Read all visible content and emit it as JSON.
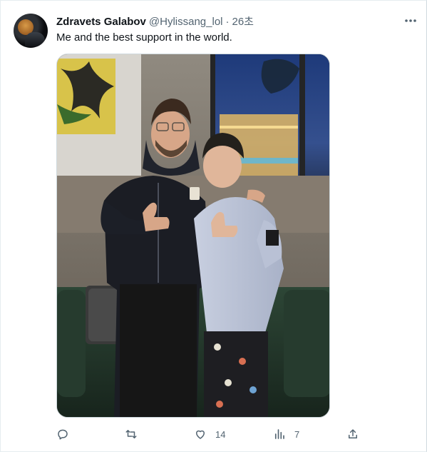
{
  "tweet": {
    "author_name": "Zdravets Galabov",
    "handle": "@Hylissang_lol",
    "separator": "·",
    "time": "26초",
    "text": "Me and the best support in the world.",
    "more_glyph": "•••"
  },
  "actions": {
    "reply": {
      "icon": "reply-icon",
      "count": ""
    },
    "retweet": {
      "icon": "retweet-icon",
      "count": ""
    },
    "like": {
      "icon": "heart-icon",
      "count": "14"
    },
    "views": {
      "icon": "views-icon",
      "count": "7"
    },
    "share": {
      "icon": "share-icon",
      "count": ""
    }
  },
  "colors": {
    "text_primary": "#0f1419",
    "text_secondary": "#536471",
    "border": "#cfd9de"
  }
}
